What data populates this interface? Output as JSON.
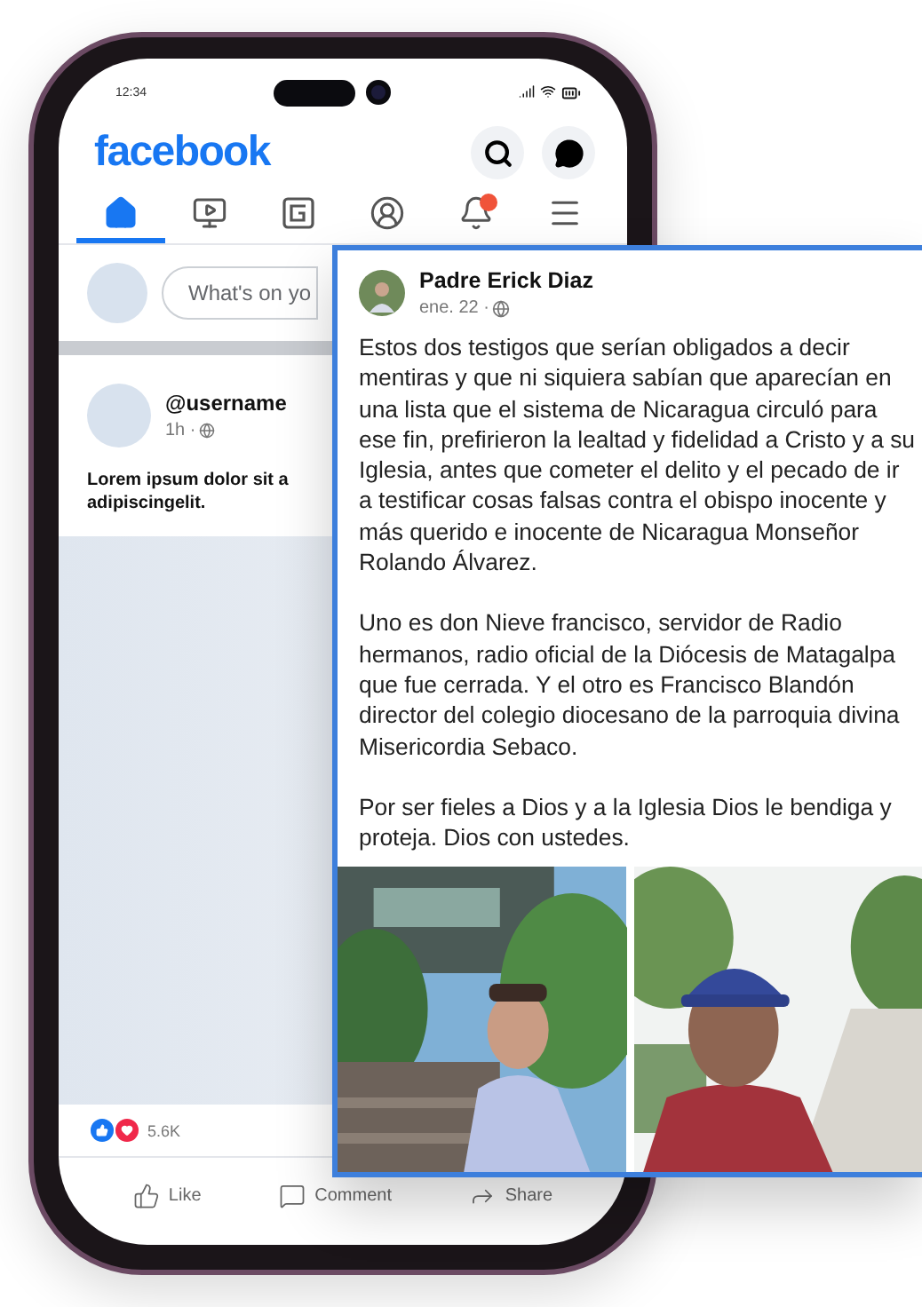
{
  "status_bar": {
    "time": "12:34"
  },
  "header": {
    "logo": "facebook"
  },
  "tabs": [
    {
      "kind": "home",
      "selected": true
    },
    {
      "kind": "video",
      "selected": false
    },
    {
      "kind": "groups",
      "selected": false
    },
    {
      "kind": "profile",
      "selected": false
    },
    {
      "kind": "notifications",
      "selected": false,
      "badge": true
    },
    {
      "kind": "menu",
      "selected": false
    }
  ],
  "composer": {
    "placeholder": "What's on yo"
  },
  "post": {
    "author": "@username",
    "time": "1h ·",
    "text_lines": [
      "Lorem ipsum dolor sit a",
      "adipiscingelit."
    ],
    "reactions": "5.6K",
    "actions": [
      {
        "kind": "like",
        "label": "Like"
      },
      {
        "kind": "comment",
        "label": "Comment"
      },
      {
        "kind": "share",
        "label": "Share"
      }
    ]
  },
  "shared_post": {
    "author": "Padre Erick Diaz",
    "time": "ene. 22 ·",
    "paragraphs": [
      "Estos dos testigos que serían obligados a decir mentiras y que ni siquiera sabían que aparecían en una lista que el sistema de Nicaragua circuló para ese fin, prefirieron la lealtad y fidelidad a Cristo y a su Iglesia, antes que cometer el delito y el pecado de ir a testificar cosas falsas contra el obispo inocente y más querido e inocente de Nicaragua Monseñor Rolando Álvarez.",
      "Uno es don Nieve francisco, servidor de Radio hermanos, radio oficial de la Diócesis de Matagalpa que fue cerrada. Y el otro es Francisco Blandón director del colegio diocesano de la parroquia divina Misericordia Sebaco.",
      "Por ser fieles a Dios y a la Iglesia Dios le bendiga y proteja. Dios con ustedes."
    ]
  }
}
